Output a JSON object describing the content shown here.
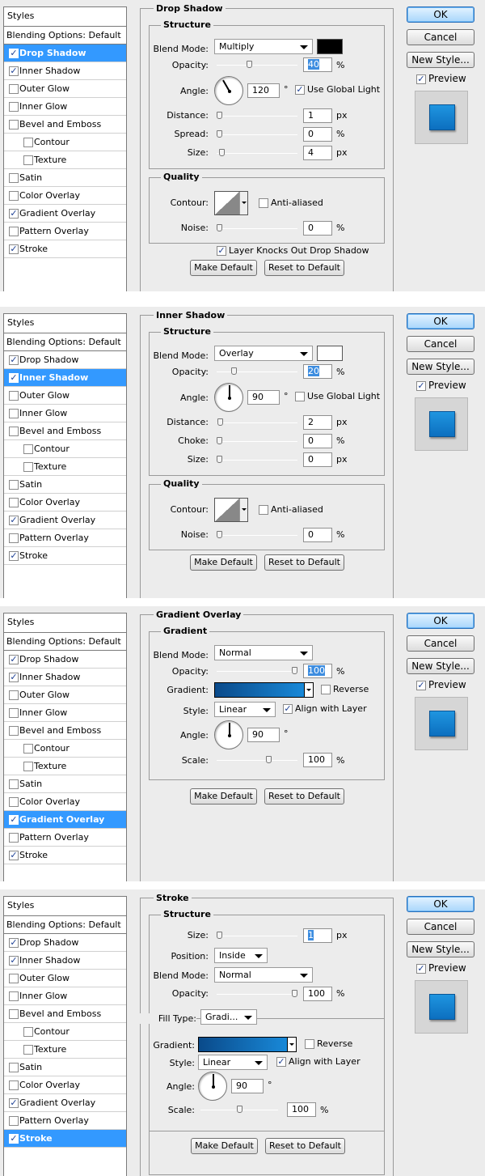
{
  "common": {
    "styles_header": "Styles",
    "blending_options": "Blending Options: Default",
    "ok": "OK",
    "cancel": "Cancel",
    "new_style": "New Style...",
    "preview": "Preview",
    "make_default": "Make Default",
    "reset_default": "Reset to Default",
    "px": "px",
    "pct": "%",
    "deg": "°"
  },
  "panels": [
    {
      "title": "Drop Shadow",
      "sidebar": [
        {
          "label": "Drop Shadow",
          "checked": true,
          "selected": true,
          "sub": false
        },
        {
          "label": "Inner Shadow",
          "checked": true,
          "selected": false,
          "sub": false
        },
        {
          "label": "Outer Glow",
          "checked": false,
          "selected": false,
          "sub": false
        },
        {
          "label": "Inner Glow",
          "checked": false,
          "selected": false,
          "sub": false
        },
        {
          "label": "Bevel and Emboss",
          "checked": false,
          "selected": false,
          "sub": false
        },
        {
          "label": "Contour",
          "checked": false,
          "selected": false,
          "sub": true
        },
        {
          "label": "Texture",
          "checked": false,
          "selected": false,
          "sub": true
        },
        {
          "label": "Satin",
          "checked": false,
          "selected": false,
          "sub": false
        },
        {
          "label": "Color Overlay",
          "checked": false,
          "selected": false,
          "sub": false
        },
        {
          "label": "Gradient Overlay",
          "checked": true,
          "selected": false,
          "sub": false
        },
        {
          "label": "Pattern Overlay",
          "checked": false,
          "selected": false,
          "sub": false
        },
        {
          "label": "Stroke",
          "checked": true,
          "selected": false,
          "sub": false
        }
      ],
      "structure": {
        "title": "Structure",
        "blend_mode_label": "Blend Mode:",
        "blend_mode": "Multiply",
        "color": "#000000",
        "opacity_label": "Opacity:",
        "opacity": "40",
        "opacity_level": 0.4,
        "angle_label": "Angle:",
        "angle": "120",
        "use_global_light": "Use Global Light",
        "use_global_light_checked": true,
        "distance_label": "Distance:",
        "distance": "1",
        "spread_label": "Spread:",
        "spread": "0",
        "size_label": "Size:",
        "size": "4"
      },
      "quality": {
        "title": "Quality",
        "contour_label": "Contour:",
        "anti_aliased": "Anti-aliased",
        "anti_aliased_checked": false,
        "noise_label": "Noise:",
        "noise": "0"
      },
      "knockout": "Layer Knocks Out Drop Shadow",
      "knockout_checked": true
    },
    {
      "title": "Inner Shadow",
      "sidebar": [
        {
          "label": "Drop Shadow",
          "checked": true,
          "selected": false,
          "sub": false
        },
        {
          "label": "Inner Shadow",
          "checked": true,
          "selected": true,
          "sub": false
        },
        {
          "label": "Outer Glow",
          "checked": false,
          "selected": false,
          "sub": false
        },
        {
          "label": "Inner Glow",
          "checked": false,
          "selected": false,
          "sub": false
        },
        {
          "label": "Bevel and Emboss",
          "checked": false,
          "selected": false,
          "sub": false
        },
        {
          "label": "Contour",
          "checked": false,
          "selected": false,
          "sub": true
        },
        {
          "label": "Texture",
          "checked": false,
          "selected": false,
          "sub": true
        },
        {
          "label": "Satin",
          "checked": false,
          "selected": false,
          "sub": false
        },
        {
          "label": "Color Overlay",
          "checked": false,
          "selected": false,
          "sub": false
        },
        {
          "label": "Gradient Overlay",
          "checked": true,
          "selected": false,
          "sub": false
        },
        {
          "label": "Pattern Overlay",
          "checked": false,
          "selected": false,
          "sub": false
        },
        {
          "label": "Stroke",
          "checked": true,
          "selected": false,
          "sub": false
        }
      ],
      "structure": {
        "title": "Structure",
        "blend_mode_label": "Blend Mode:",
        "blend_mode": "Overlay",
        "color": "#ffffff",
        "opacity_label": "Opacity:",
        "opacity": "20",
        "opacity_level": 0.2,
        "angle_label": "Angle:",
        "angle": "90",
        "use_global_light": "Use Global Light",
        "use_global_light_checked": false,
        "distance_label": "Distance:",
        "distance": "2",
        "spread_label": "Choke:",
        "spread": "0",
        "size_label": "Size:",
        "size": "0"
      },
      "quality": {
        "title": "Quality",
        "contour_label": "Contour:",
        "anti_aliased": "Anti-aliased",
        "anti_aliased_checked": false,
        "noise_label": "Noise:",
        "noise": "0"
      }
    },
    {
      "title": "Gradient Overlay",
      "sidebar": [
        {
          "label": "Drop Shadow",
          "checked": true,
          "selected": false,
          "sub": false
        },
        {
          "label": "Inner Shadow",
          "checked": true,
          "selected": false,
          "sub": false
        },
        {
          "label": "Outer Glow",
          "checked": false,
          "selected": false,
          "sub": false
        },
        {
          "label": "Inner Glow",
          "checked": false,
          "selected": false,
          "sub": false
        },
        {
          "label": "Bevel and Emboss",
          "checked": false,
          "selected": false,
          "sub": false
        },
        {
          "label": "Contour",
          "checked": false,
          "selected": false,
          "sub": true
        },
        {
          "label": "Texture",
          "checked": false,
          "selected": false,
          "sub": true
        },
        {
          "label": "Satin",
          "checked": false,
          "selected": false,
          "sub": false
        },
        {
          "label": "Color Overlay",
          "checked": false,
          "selected": false,
          "sub": false
        },
        {
          "label": "Gradient Overlay",
          "checked": true,
          "selected": true,
          "sub": false
        },
        {
          "label": "Pattern Overlay",
          "checked": false,
          "selected": false,
          "sub": false
        },
        {
          "label": "Stroke",
          "checked": true,
          "selected": false,
          "sub": false
        }
      ],
      "gradient": {
        "title": "Gradient",
        "blend_mode_label": "Blend Mode:",
        "blend_mode": "Normal",
        "opacity_label": "Opacity:",
        "opacity": "100",
        "opacity_level": 1.0,
        "gradient_label": "Gradient:",
        "reverse": "Reverse",
        "reverse_checked": false,
        "style_label": "Style:",
        "style": "Linear",
        "align": "Align with Layer",
        "align_checked": true,
        "angle_label": "Angle:",
        "angle": "90",
        "scale_label": "Scale:",
        "scale": "100",
        "scale_level": 0.67
      }
    },
    {
      "title": "Stroke",
      "sidebar": [
        {
          "label": "Drop Shadow",
          "checked": true,
          "selected": false,
          "sub": false
        },
        {
          "label": "Inner Shadow",
          "checked": true,
          "selected": false,
          "sub": false
        },
        {
          "label": "Outer Glow",
          "checked": false,
          "selected": false,
          "sub": false
        },
        {
          "label": "Inner Glow",
          "checked": false,
          "selected": false,
          "sub": false
        },
        {
          "label": "Bevel and Emboss",
          "checked": false,
          "selected": false,
          "sub": false
        },
        {
          "label": "Contour",
          "checked": false,
          "selected": false,
          "sub": true
        },
        {
          "label": "Texture",
          "checked": false,
          "selected": false,
          "sub": true
        },
        {
          "label": "Satin",
          "checked": false,
          "selected": false,
          "sub": false
        },
        {
          "label": "Color Overlay",
          "checked": false,
          "selected": false,
          "sub": false
        },
        {
          "label": "Gradient Overlay",
          "checked": true,
          "selected": false,
          "sub": false
        },
        {
          "label": "Pattern Overlay",
          "checked": false,
          "selected": false,
          "sub": false
        },
        {
          "label": "Stroke",
          "checked": true,
          "selected": true,
          "sub": false
        }
      ],
      "structure": {
        "title": "Structure",
        "size_label": "Size:",
        "size": "1",
        "position_label": "Position:",
        "position": "Inside",
        "blend_mode_label": "Blend Mode:",
        "blend_mode": "Normal",
        "opacity_label": "Opacity:",
        "opacity": "100",
        "opacity_level": 1.0
      },
      "fill": {
        "fill_type_label": "Fill Type:",
        "fill_type": "Gradi...",
        "gradient_label": "Gradient:",
        "reverse": "Reverse",
        "reverse_checked": false,
        "style_label": "Style:",
        "style": "Linear",
        "align": "Align with Layer",
        "align_checked": true,
        "angle_label": "Angle:",
        "angle": "90",
        "scale_label": "Scale:",
        "scale": "100",
        "scale_level": 0.5
      }
    }
  ]
}
